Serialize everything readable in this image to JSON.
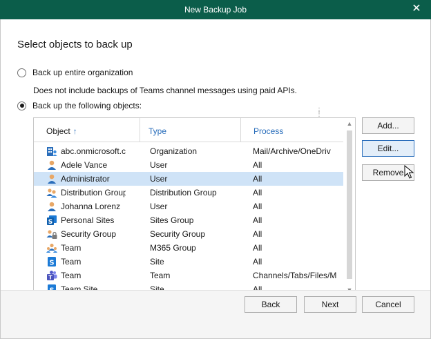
{
  "window": {
    "title": "New Backup Job"
  },
  "heading": "Select objects to back up",
  "options": {
    "entire_org": {
      "label": "Back up entire organization",
      "checked": false
    },
    "note": "Does not include backups of Teams channel messages using paid APIs.",
    "following": {
      "label": "Back up the following objects:",
      "checked": true
    }
  },
  "grid": {
    "columns": {
      "object": "Object",
      "type": "Type",
      "process": "Process"
    },
    "sort_arrow": "↑",
    "rows": [
      {
        "icon": "organization-icon",
        "object": "abc.onmicrosoft.c",
        "type": "Organization",
        "process": "Mail/Archive/OneDriv",
        "selected": false
      },
      {
        "icon": "user-icon",
        "object": "Adele Vance",
        "type": "User",
        "process": "All",
        "selected": false
      },
      {
        "icon": "user-icon",
        "object": "Administrator",
        "type": "User",
        "process": "All",
        "selected": true
      },
      {
        "icon": "group-icon",
        "object": "Distribution Group",
        "type": "Distribution Group",
        "process": "All",
        "selected": false
      },
      {
        "icon": "user-icon",
        "object": "Johanna Lorenz",
        "type": "User",
        "process": "All",
        "selected": false
      },
      {
        "icon": "sites-icon",
        "object": "Personal Sites",
        "type": "Sites Group",
        "process": "All",
        "selected": false
      },
      {
        "icon": "security-group-icon",
        "object": "Security Group",
        "type": "Security Group",
        "process": "All",
        "selected": false
      },
      {
        "icon": "m365-group-icon",
        "object": "Team",
        "type": "M365 Group",
        "process": "All",
        "selected": false
      },
      {
        "icon": "sharepoint-site-icon",
        "object": "Team",
        "type": "Site",
        "process": "All",
        "selected": false
      },
      {
        "icon": "teams-icon",
        "object": "Team",
        "type": "Team",
        "process": "Channels/Tabs/Files/M",
        "selected": false
      },
      {
        "icon": "sharepoint-site-icon",
        "object": "Team Site",
        "type": "Site",
        "process": "All",
        "selected": false
      }
    ]
  },
  "side_buttons": {
    "add": "Add...",
    "edit": "Edit...",
    "remove": "Remove"
  },
  "footer_buttons": {
    "back": "Back",
    "next": "Next",
    "cancel": "Cancel"
  },
  "colors": {
    "titlebar": "#0b5d4a",
    "selection": "#cfe3f7",
    "link_header": "#2a6ebb"
  }
}
